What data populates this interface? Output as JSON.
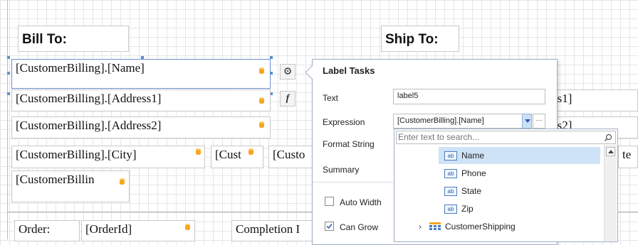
{
  "report": {
    "bill_to": "Bill To:",
    "ship_to": "Ship To:",
    "name_field": "[CustomerBilling].[Name]",
    "address1_field": "[CustomerBilling].[Address1]",
    "address2_field": "[CustomerBilling].[Address2]",
    "city_field": "[CustomerBilling].[City]",
    "cust_field_a": "[Cust",
    "custo_field_b": "[Custo",
    "billing_trunc": "[CustomerBillin",
    "ship_address1_trunc": "ss1]",
    "ship_address2_trunc": "ss2]",
    "ship_city_trunc": "te",
    "order_label": "Order:",
    "order_id": "[OrderId]",
    "completion": "Completion I"
  },
  "side_buttons": {
    "tasks_icon": "gear-icon",
    "expression_icon": "function-icon",
    "expression_glyph": "f"
  },
  "label_tasks": {
    "title": "Label Tasks",
    "text_label": "Text",
    "text_value": "label5",
    "expression_label": "Expression",
    "expression_value": "[CustomerBilling].[Name]",
    "expression_more": "···",
    "format_string_label": "Format String",
    "summary_label": "Summary",
    "auto_width_label": "Auto Width",
    "auto_width_checked": false,
    "can_grow_label": "Can Grow",
    "can_grow_checked": true
  },
  "field_picker": {
    "search_placeholder": "Enter text to search...",
    "items": [
      {
        "icon": "ab",
        "label": "Name",
        "selected": true
      },
      {
        "icon": "ab",
        "label": "Phone",
        "selected": false
      },
      {
        "icon": "ab",
        "label": "State",
        "selected": false
      },
      {
        "icon": "ab",
        "label": "Zip",
        "selected": false
      }
    ],
    "group_label": "CustomerShipping",
    "group_icon": "table-icon"
  },
  "colors": {
    "accent": "#4a7bc0",
    "selection": "#cfe3f7",
    "db_icon": "#f5a623"
  }
}
